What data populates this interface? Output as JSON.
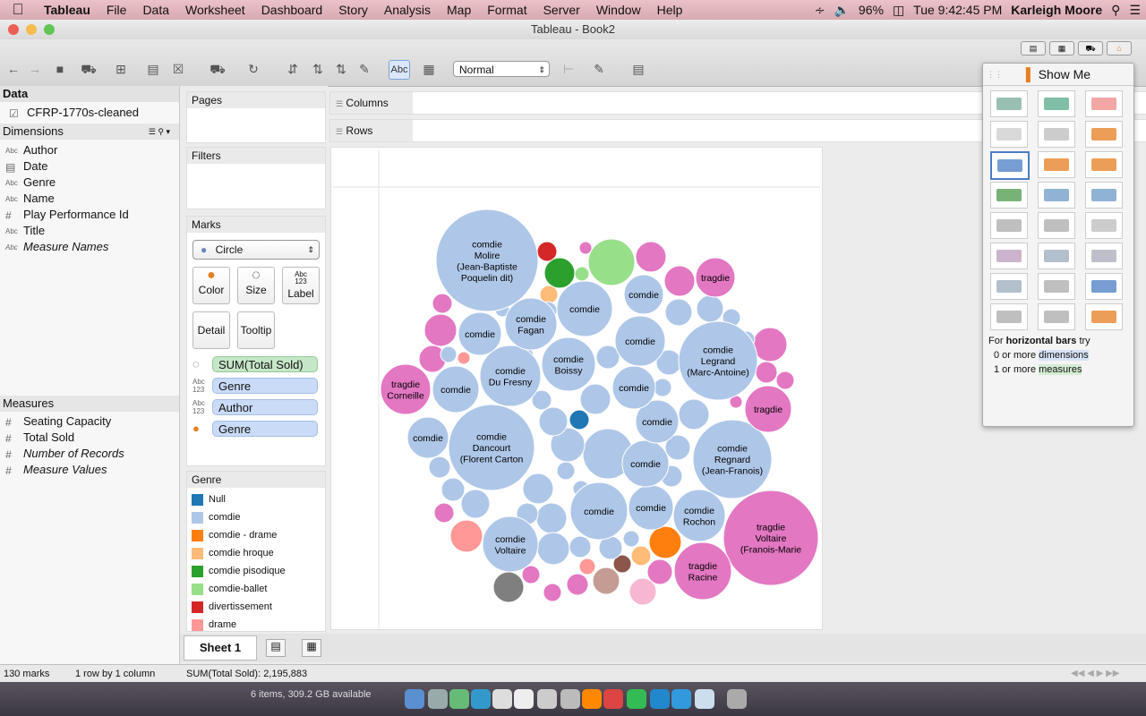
{
  "menubar": {
    "apple": "",
    "items": [
      "Tableau",
      "File",
      "Data",
      "Worksheet",
      "Dashboard",
      "Story",
      "Analysis",
      "Map",
      "Format",
      "Server",
      "Window",
      "Help"
    ],
    "battery": "96%",
    "clock": "Tue 9:42:45 PM",
    "user": "Karleigh Moore"
  },
  "window": {
    "title": "Tableau - Book2"
  },
  "toolbar": {
    "mark_size_select": "Normal",
    "abc_label": "Abc"
  },
  "data_pane": {
    "header": "Data",
    "datasource": "CFRP-1770s-cleaned",
    "dimensions_header": "Dimensions",
    "dimensions": [
      {
        "icon": "Abc",
        "label": "Author",
        "italic": false
      },
      {
        "icon": "date",
        "label": "Date",
        "italic": false
      },
      {
        "icon": "Abc",
        "label": "Genre",
        "italic": false
      },
      {
        "icon": "Abc",
        "label": "Name",
        "italic": false
      },
      {
        "icon": "#",
        "label": "Play Performance Id",
        "italic": false
      },
      {
        "icon": "Abc",
        "label": "Title",
        "italic": false
      },
      {
        "icon": "Abc",
        "label": "Measure Names",
        "italic": true
      }
    ],
    "measures_header": "Measures",
    "measures": [
      {
        "label": "Seating Capacity",
        "italic": false
      },
      {
        "label": "Total Sold",
        "italic": false
      },
      {
        "label": "Number of Records",
        "italic": true
      },
      {
        "label": "Measure Values",
        "italic": true
      }
    ]
  },
  "cards": {
    "pages": "Pages",
    "filters": "Filters",
    "marks": "Marks",
    "mark_type": "Circle",
    "buttons": [
      "Color",
      "Size",
      "Label",
      "Detail",
      "Tooltip"
    ],
    "label_icon": "Abc\n123",
    "pills": [
      "SUM(Total Sold)",
      "Genre",
      "Author",
      "Genre"
    ],
    "legend_title": "Genre",
    "legend": [
      {
        "label": "Null",
        "color": "#1f77b4"
      },
      {
        "label": "comdie",
        "color": "#aec7e8"
      },
      {
        "label": "comdie - drame",
        "color": "#ff7f0e"
      },
      {
        "label": "comdie hroque",
        "color": "#ffbb78"
      },
      {
        "label": "comdie pisodique",
        "color": "#2ca02c"
      },
      {
        "label": "comdie-ballet",
        "color": "#98df8a"
      },
      {
        "label": "divertissement",
        "color": "#d62728"
      },
      {
        "label": "drame",
        "color": "#ff9896"
      }
    ]
  },
  "shelves": {
    "columns": "Columns",
    "rows": "Rows"
  },
  "show_me": {
    "title": "Show Me",
    "hint_prefix": "For ",
    "hint_bold": "horizontal bars",
    "hint_suffix": " try",
    "hint_dim_count": "0 or more ",
    "hint_dim": "dimensions",
    "hint_meas_count": "1 or more ",
    "hint_meas": "measures"
  },
  "tabs": {
    "sheet": "Sheet 1"
  },
  "status": {
    "marks": "130 marks",
    "rows": "1 row by 1 column",
    "sum": "SUM(Total Sold): 2,195,883"
  },
  "desktop": {
    "disk": "6 items, 309.2 GB available"
  },
  "chart_data": {
    "type": "packed-bubble",
    "measure": "SUM(Total Sold)",
    "color_by": "Genre",
    "bubbles": [
      {
        "label": "comdie\nMolire\n(Jean-Baptiste\nPoquelin dit)",
        "genre": "comdie",
        "color": "#aec7e8"
      },
      {
        "label": "comdie\nDancourt\n(Florent Carton",
        "genre": "comdie",
        "color": "#aec7e8"
      },
      {
        "label": "tragdie\nVoltaire\n(Franois-Marie",
        "genre": "tragdie",
        "color": "#e377c2"
      },
      {
        "label": "comdie\nLegrand\n(Marc-Antoine)",
        "genre": "comdie",
        "color": "#aec7e8"
      },
      {
        "label": "comdie\nRegnard\n(Jean-Franois)",
        "genre": "comdie",
        "color": "#aec7e8"
      },
      {
        "label": "tragdie\nRacine",
        "genre": "tragdie",
        "color": "#e377c2"
      },
      {
        "label": "tragdie\nCorneille",
        "genre": "tragdie",
        "color": "#e377c2"
      },
      {
        "label": "comdie\nVoltaire",
        "genre": "comdie",
        "color": "#aec7e8"
      },
      {
        "label": "comdie\nDu Fresny",
        "genre": "comdie",
        "color": "#aec7e8"
      },
      {
        "label": "comdie",
        "genre": "comdie",
        "color": "#aec7e8"
      },
      {
        "label": "comdie\nBoissy",
        "genre": "comdie",
        "color": "#aec7e8"
      },
      {
        "label": "comdie",
        "genre": "comdie",
        "color": "#aec7e8"
      },
      {
        "label": "comdie\nFagan",
        "genre": "comdie",
        "color": "#aec7e8"
      },
      {
        "label": "comdie\nRochon",
        "genre": "comdie",
        "color": "#aec7e8"
      },
      {
        "label": "comdie",
        "genre": "comdie",
        "color": "#aec7e8"
      },
      {
        "label": "comdie",
        "genre": "comdie",
        "color": "#aec7e8"
      },
      {
        "label": "comdie",
        "genre": "comdie",
        "color": "#aec7e8"
      },
      {
        "label": "comdie",
        "genre": "comdie",
        "color": "#aec7e8"
      },
      {
        "label": "comdie",
        "genre": "comdie",
        "color": "#aec7e8"
      },
      {
        "label": "comdie",
        "genre": "comdie",
        "color": "#aec7e8"
      },
      {
        "label": "comdie",
        "genre": "comdie",
        "color": "#aec7e8"
      },
      {
        "label": "comdie",
        "genre": "comdie",
        "color": "#aec7e8"
      },
      {
        "label": "comdie",
        "genre": "comdie",
        "color": "#aec7e8"
      },
      {
        "label": "tragdie",
        "genre": "tragdie",
        "color": "#e377c2"
      },
      {
        "label": "tragdie",
        "genre": "tragdie",
        "color": "#e377c2"
      }
    ]
  }
}
